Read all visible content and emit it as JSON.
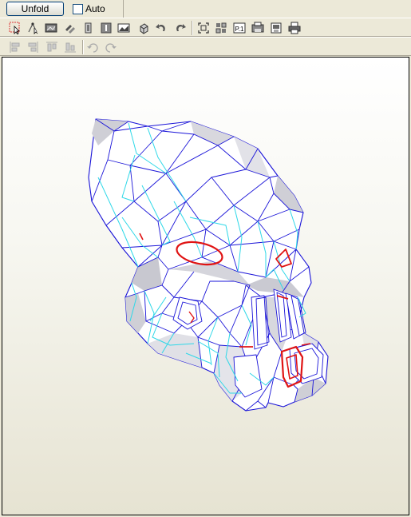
{
  "toolbar": {
    "unfold_label": "Unfold",
    "auto_label": "Auto",
    "auto_checked": false
  },
  "colors": {
    "outline": "#1a14d8",
    "fold": "#2ed8e8",
    "cut": "#e01414",
    "shade": "#cfcfd6",
    "surface": "#ffffff",
    "viewport_top": "#ffffff",
    "viewport_bottom": "#e6e3d2"
  },
  "icons_row1": [
    "select-arrow-icon",
    "pick-edge-icon",
    "texture-icon",
    "flap-icon",
    "join-icon",
    "part-icon",
    "image-icon",
    "rotate-part-icon",
    "undo-icon",
    "redo-icon",
    "fit-view-icon",
    "arrange-icon",
    "page-p1-icon",
    "print-preview-icon",
    "save-page-icon",
    "printer-icon"
  ],
  "icons_row2": [
    "align-left-icon",
    "align-right-icon",
    "align-top-icon",
    "align-bottom-icon",
    "rotate-ccw-90-icon",
    "rotate-cw-90-icon"
  ]
}
